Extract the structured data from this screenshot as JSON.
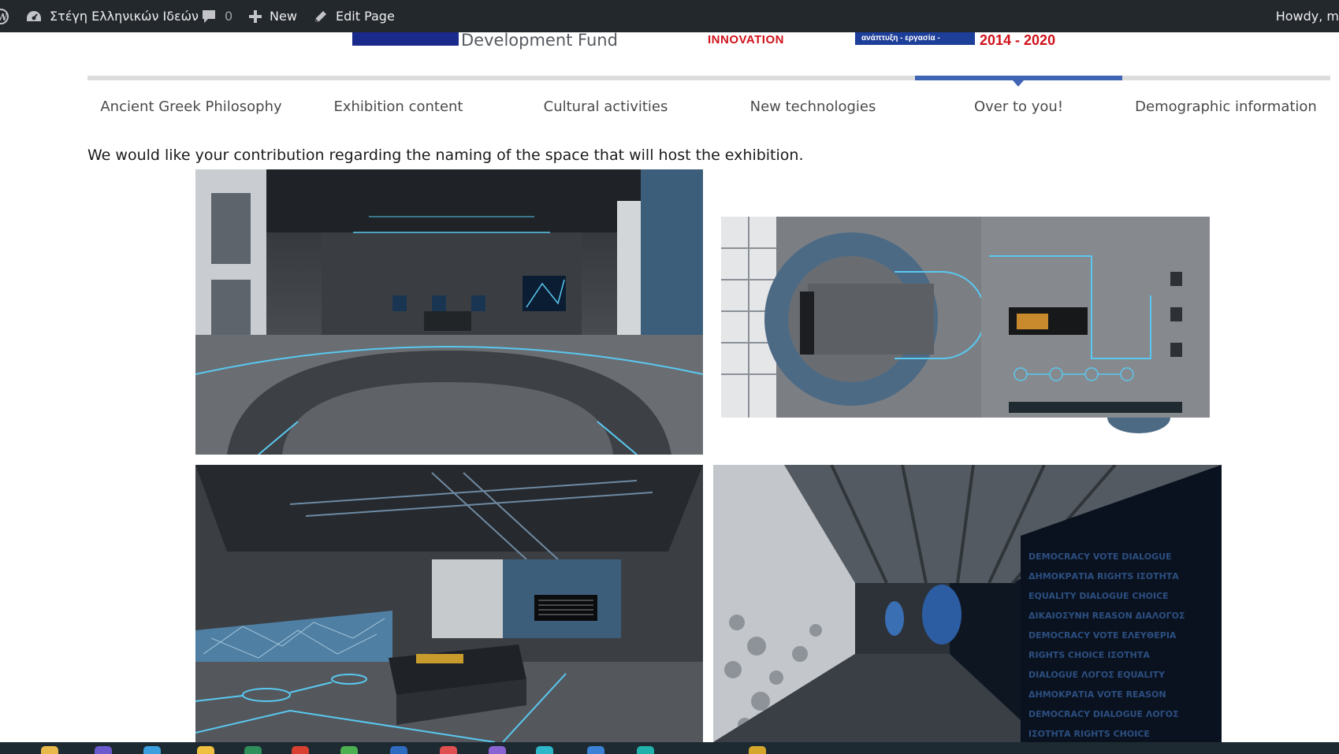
{
  "admin_bar": {
    "site_name": "Στέγη Ελληνικών Ιδεών",
    "comments_count": "0",
    "new_label": "New",
    "edit_label": "Edit Page",
    "howdy": "Howdy, m"
  },
  "header": {
    "fund_text": "Development Fund",
    "innovation_text": "INNOVATION",
    "espa_text": "ανάπτυξη - εργασία - αλληλεγγύη",
    "period_text": "2014 - 2020"
  },
  "tabs": [
    {
      "label": "Ancient Greek Philosophy",
      "active": false
    },
    {
      "label": "Exhibition content",
      "active": false
    },
    {
      "label": "Cultural activities",
      "active": false
    },
    {
      "label": "New technologies",
      "active": false
    },
    {
      "label": "Over to you!",
      "active": true
    },
    {
      "label": "Demographic information",
      "active": false
    }
  ],
  "intro_text": "We would like your contribution regarding the naming of the space that will host the exhibition.",
  "colors": {
    "admin_bar_bg": "#23282d",
    "tab_active": "#3f64b3",
    "tab_track": "#dddddd",
    "eu_blue": "#1a2a8c",
    "espa_red": "#d0121b",
    "neon_cyan": "#5ac8f0"
  }
}
